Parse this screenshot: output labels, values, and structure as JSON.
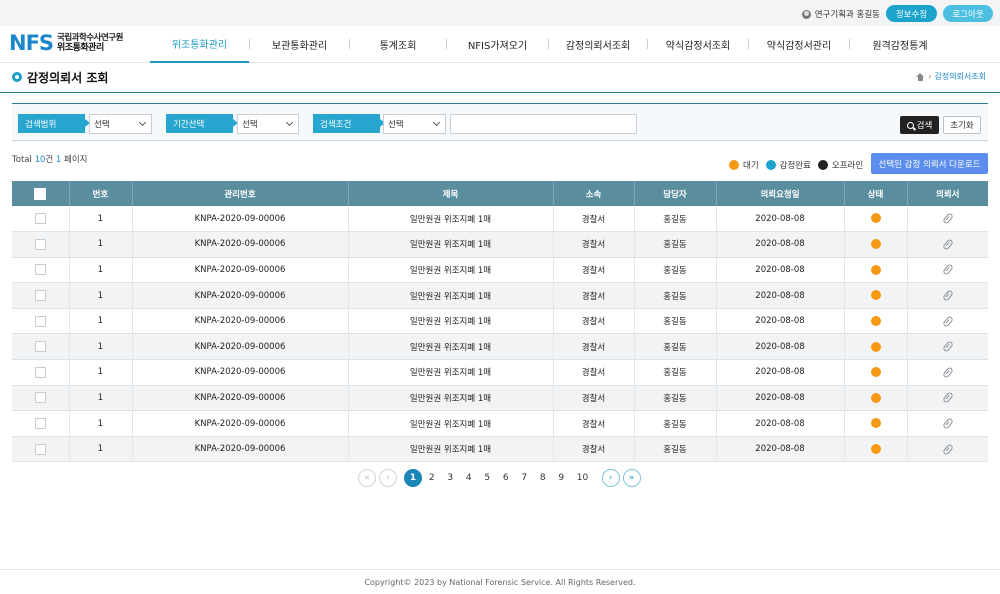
{
  "topbar": {
    "user_label": "연구기획과 홍길동",
    "edit_profile_label": "정보수정",
    "logout_label": "로그아웃"
  },
  "logo": {
    "mark": "NFS",
    "line1": "국립과학수사연구원",
    "line2": "위조통화관리"
  },
  "nav": [
    {
      "label": "위조통화관리",
      "active": true
    },
    {
      "label": "보관통화관리",
      "active": false
    },
    {
      "label": "통계조회",
      "active": false
    },
    {
      "label": "NFIS가져오기",
      "active": false
    },
    {
      "label": "감정의뢰서조회",
      "active": false
    },
    {
      "label": "약식감정서조회",
      "active": false
    },
    {
      "label": "약식감정서관리",
      "active": false
    },
    {
      "label": "원격감정통계",
      "active": false
    }
  ],
  "page": {
    "title": "감정의뢰서 조회",
    "breadcrumb": "감정의뢰서조회"
  },
  "search": {
    "range_label": "검색범위",
    "range_value": "선택",
    "period_label": "기간선택",
    "period_value": "선택",
    "condition_label": "검색조건",
    "condition_value": "선택",
    "keyword_value": "",
    "search_button": "검색",
    "reset_button": "초기화"
  },
  "summary": {
    "prefix": "Total",
    "count": "10",
    "count_unit": "건",
    "page": "1",
    "page_unit": "페이지"
  },
  "legend": [
    {
      "label": "대기",
      "color": "#f59a15"
    },
    {
      "label": "감정완료",
      "color": "#1ba3cc"
    },
    {
      "label": "오프라인",
      "color": "#222222"
    }
  ],
  "download_button": "선택된 감정 의뢰서 다운로드",
  "table": {
    "columns": [
      "",
      "번호",
      "관리번호",
      "제목",
      "소속",
      "담당자",
      "의뢰요청일",
      "상태",
      "의뢰서"
    ],
    "rows": [
      {
        "no": "1",
        "id": "KNPA-2020-09-00006",
        "title": "일만원권 위조지폐 1매",
        "org": "경찰서",
        "manager": "홍길동",
        "date": "2020-08-08",
        "status": "대기"
      },
      {
        "no": "1",
        "id": "KNPA-2020-09-00006",
        "title": "일만원권 위조지폐 1매",
        "org": "경찰서",
        "manager": "홍길동",
        "date": "2020-08-08",
        "status": "대기"
      },
      {
        "no": "1",
        "id": "KNPA-2020-09-00006",
        "title": "일만원권 위조지폐 1매",
        "org": "경찰서",
        "manager": "홍길동",
        "date": "2020-08-08",
        "status": "대기"
      },
      {
        "no": "1",
        "id": "KNPA-2020-09-00006",
        "title": "일만원권 위조지폐 1매",
        "org": "경찰서",
        "manager": "홍길동",
        "date": "2020-08-08",
        "status": "대기"
      },
      {
        "no": "1",
        "id": "KNPA-2020-09-00006",
        "title": "일만원권 위조지폐 1매",
        "org": "경찰서",
        "manager": "홍길동",
        "date": "2020-08-08",
        "status": "대기"
      },
      {
        "no": "1",
        "id": "KNPA-2020-09-00006",
        "title": "일만원권 위조지폐 1매",
        "org": "경찰서",
        "manager": "홍길동",
        "date": "2020-08-08",
        "status": "대기"
      },
      {
        "no": "1",
        "id": "KNPA-2020-09-00006",
        "title": "일만원권 위조지폐 1매",
        "org": "경찰서",
        "manager": "홍길동",
        "date": "2020-08-08",
        "status": "대기"
      },
      {
        "no": "1",
        "id": "KNPA-2020-09-00006",
        "title": "일만원권 위조지폐 1매",
        "org": "경찰서",
        "manager": "홍길동",
        "date": "2020-08-08",
        "status": "대기"
      },
      {
        "no": "1",
        "id": "KNPA-2020-09-00006",
        "title": "일만원권 위조지폐 1매",
        "org": "경찰서",
        "manager": "홍길동",
        "date": "2020-08-08",
        "status": "대기"
      },
      {
        "no": "1",
        "id": "KNPA-2020-09-00006",
        "title": "일만원권 위조지폐 1매",
        "org": "경찰서",
        "manager": "홍길동",
        "date": "2020-08-08",
        "status": "대기"
      }
    ]
  },
  "pagination": {
    "first": "«",
    "prev": "‹",
    "pages": [
      "1",
      "2",
      "3",
      "4",
      "5",
      "6",
      "7",
      "8",
      "9",
      "10"
    ],
    "current": "1",
    "next": "›",
    "last": "»"
  },
  "footer": "Copyright© 2023 by National Forensic Service. All Rights Reserved."
}
